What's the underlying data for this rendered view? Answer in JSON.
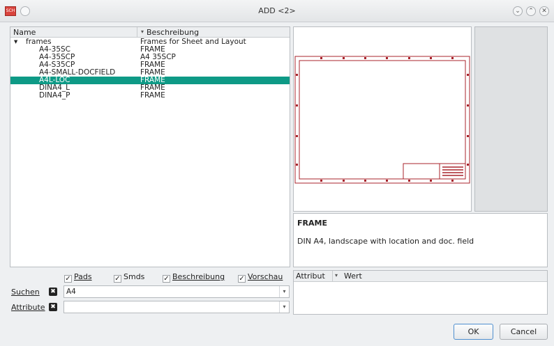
{
  "window": {
    "title": "ADD <2>",
    "app_icon": "SCH"
  },
  "tree": {
    "header": {
      "name": "Name",
      "description": "Beschreibung"
    },
    "rows": [
      {
        "name": "frames",
        "desc": "Frames for Sheet and Layout",
        "expander": "▾"
      },
      {
        "name": "A4-35SC",
        "desc": "FRAME"
      },
      {
        "name": "A4-35SCP",
        "desc": "A4 35SCP"
      },
      {
        "name": "A4-S35CP",
        "desc": "FRAME"
      },
      {
        "name": "A4-SMALL-DOCFIELD",
        "desc": "FRAME"
      },
      {
        "name": "A4L-LOC",
        "desc": "FRAME",
        "selected": true
      },
      {
        "name": "DINA4_L",
        "desc": "FRAME"
      },
      {
        "name": "DINA4_P",
        "desc": "FRAME"
      }
    ]
  },
  "description": {
    "title": "FRAME",
    "text": "DIN A4, landscape with location and doc. field"
  },
  "options": {
    "pads": {
      "label": "Pads",
      "checked": true
    },
    "smds": {
      "label": "Smds",
      "checked": true
    },
    "beschreibung": {
      "label": "Beschreibung",
      "checked": true
    },
    "vorschau": {
      "label": "Vorschau",
      "checked": true
    }
  },
  "search": {
    "label": "Suchen",
    "value": "A4"
  },
  "attribute": {
    "label": "Attribute",
    "value": ""
  },
  "attr_table": {
    "col1": "Attribut",
    "col2": "Wert"
  },
  "buttons": {
    "ok": "OK",
    "cancel": "Cancel"
  },
  "colors": {
    "selection": "#0e9a86",
    "frame": "#a8232b"
  },
  "icons": {
    "sort": "▾",
    "check": "✓",
    "clear": "✖",
    "dropdown": "▾",
    "minimize": "⌄",
    "maximize": "⌃",
    "close": "✕"
  }
}
